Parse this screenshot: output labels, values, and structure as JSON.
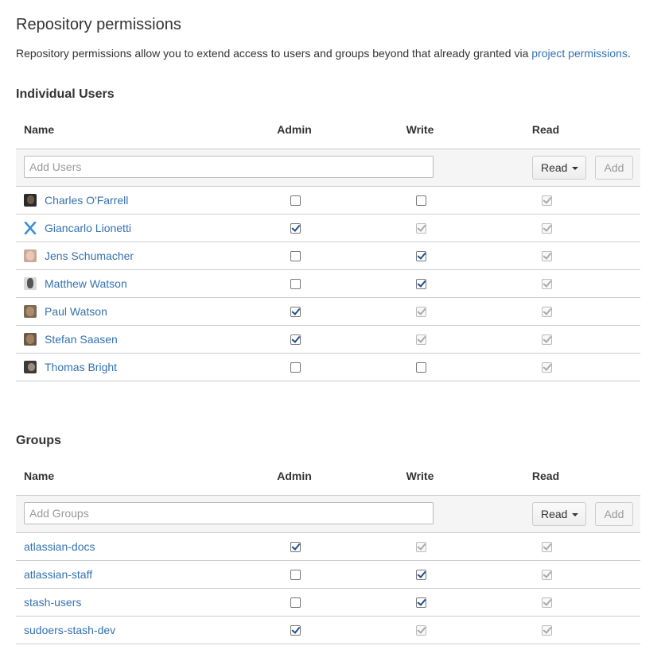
{
  "page": {
    "title": "Repository permissions",
    "description_prefix": "Repository permissions allow you to extend access to users and groups beyond that already granted via ",
    "description_link": "project permissions",
    "description_suffix": "."
  },
  "columns": {
    "name": "Name",
    "admin": "Admin",
    "write": "Write",
    "read": "Read"
  },
  "users": {
    "section_title": "Individual Users",
    "add_placeholder": "Add Users",
    "permission_select": "Read",
    "add_button": "Add",
    "rows": [
      {
        "name": "Charles O'Farrell",
        "avatar": "person-avatar-icon",
        "admin": false,
        "write": false,
        "read": true
      },
      {
        "name": "Giancarlo Lionetti",
        "avatar": "atlassian-logo-icon",
        "admin": true,
        "write": true,
        "read": true
      },
      {
        "name": "Jens Schumacher",
        "avatar": "person-avatar-icon",
        "admin": false,
        "write": true,
        "read": true
      },
      {
        "name": "Matthew Watson",
        "avatar": "person-avatar-icon",
        "admin": false,
        "write": true,
        "read": true
      },
      {
        "name": "Paul Watson",
        "avatar": "person-avatar-icon",
        "admin": true,
        "write": true,
        "read": true
      },
      {
        "name": "Stefan Saasen",
        "avatar": "person-avatar-icon",
        "admin": true,
        "write": true,
        "read": true
      },
      {
        "name": "Thomas Bright",
        "avatar": "person-avatar-icon",
        "admin": false,
        "write": false,
        "read": true
      }
    ]
  },
  "groups": {
    "section_title": "Groups",
    "add_placeholder": "Add Groups",
    "permission_select": "Read",
    "add_button": "Add",
    "rows": [
      {
        "name": "atlassian-docs",
        "admin": true,
        "write": true,
        "read": true
      },
      {
        "name": "atlassian-staff",
        "admin": false,
        "write": true,
        "read": true
      },
      {
        "name": "stash-users",
        "admin": false,
        "write": true,
        "read": true
      },
      {
        "name": "sudoers-stash-dev",
        "admin": true,
        "write": true,
        "read": true
      }
    ]
  },
  "colors": {
    "link": "#3572b0",
    "text": "#333333",
    "border": "#cccccc",
    "add_row_bg": "#f5f5f5"
  }
}
